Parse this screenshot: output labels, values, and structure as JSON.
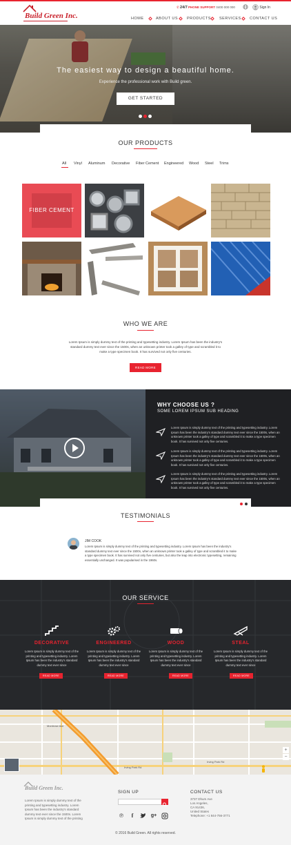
{
  "header": {
    "brand": "Build Green Inc.",
    "hours": "24/7",
    "support_label": "PHONE SUPPORT",
    "support_phone": "0400 000 000",
    "signin": "Sign In",
    "nav": [
      "HOME",
      "ABOUT US",
      "PRODUCTS",
      "SERVICES",
      "CONTACT US"
    ]
  },
  "hero": {
    "title": "The easiest way to design a beautiful home.",
    "subtitle": "Experience the professional work with Build green.",
    "button": "GET STARTED",
    "active_slide": 1
  },
  "products": {
    "title": "OUR PRODUCTS",
    "filters": [
      "All",
      "Vinyl",
      "Aluminum",
      "Decorative",
      "Fiber Cement",
      "Engineered",
      "Wood",
      "Steel",
      "Trims"
    ],
    "featured_label": "FIBER CEMENT"
  },
  "about": {
    "title": "WHO WE ARE",
    "text": "Lorem Ipsum is simply dummy text of the printing and typesetting industry. Lorem Ipsum has been the industry's standard dummy text ever since the 1500s, when an unknown printer took a galley of type and scrambled it to make a type specimen book. It has survived not only five centuries.",
    "button": "READ MORE"
  },
  "why": {
    "title": "WHY CHOOSE US ?",
    "subtitle": "SOME LOREM IPSUM SUB HEADING",
    "items": [
      "Lorem Ipsum is simply dummy text of the printing and typesetting industry. Lorem Ipsum has been the industry's standard dummy text ever since the 1500s, when an unknown printer took a galley of type and scrambled it to make a type specimen book. It has survived not only five centuries.",
      "Lorem Ipsum is simply dummy text of the printing and typesetting industry. Lorem Ipsum has been the industry's standard dummy text ever since the 1500s, when an unknown printer took a galley of type and scrambled it to make a type specimen book. It has survived not only five centuries.",
      "Lorem Ipsum is simply dummy text of the printing and typesetting industry. Lorem Ipsum has been the industry's standard dummy text ever since the 1500s, when an unknown printer took a galley of type and scrambled it to make a type specimen book. It has survived not only five centuries."
    ]
  },
  "testimonials": {
    "title": "TESTIMONIALS",
    "name": "JIM COOK",
    "text": "Lorem Ipsum is simply dummy text of the printing and typesetting industry. Lorem Ipsum has been the industry's standard dummy text ever since the 1500s, when an unknown printer took a galley of type and scrambled it to make a type specimen book. It has survived not only five centuries, but also the leap into electronic typesetting, remaining essentially unchanged. It was popularised in the 1960s."
  },
  "service": {
    "title": "OUR SERVICE",
    "items": [
      {
        "name": "DECORATIVE",
        "text": "Lorem Ipsum is simply dummy text of the printing and typesetting industry. Lorem Ipsum has been the industry's standard dummy text ever since",
        "button": "READ MORE"
      },
      {
        "name": "ENGINEERED",
        "text": "Lorem Ipsum is simply dummy text of the printing and typesetting industry. Lorem Ipsum has been the industry's standard dummy text ever since",
        "button": "READ MORE"
      },
      {
        "name": "WOOD",
        "text": "Lorem Ipsum is simply dummy text of the printing and typesetting industry. Lorem Ipsum has been the industry's standard dummy text ever since",
        "button": "READ MORE"
      },
      {
        "name": "STEAL",
        "text": "Lorem Ipsum is simply dummy text of the printing and typesetting industry. Lorem Ipsum has been the industry's standard dummy text ever since",
        "button": "READ MORE"
      }
    ]
  },
  "map": {
    "labels": [
      "Irving Park Rd",
      "Montrose Ave",
      "Irving Park Rd"
    ]
  },
  "footer": {
    "brand": "Build Green Inc.",
    "about_text": "Lorem Ipsum is simply dummy text of the printing and typesetting industry. Lorem Ipsum has been the industry's standard dummy text ever since the 1500s. Lorem Ipsum is simply dummy text of the printing",
    "signup_title": "SIGN UP",
    "contact_title": "CONTACT US",
    "contact_lines": [
      "3737 Dhum Ave",
      "Los Angeles,",
      "CA 91436,",
      "United States",
      "Telephone: +1 844-756-3771"
    ],
    "copyright": "© 2016 Build Green. All rights reserved."
  },
  "colors": {
    "accent": "#e8232f",
    "dark": "#26282b"
  }
}
